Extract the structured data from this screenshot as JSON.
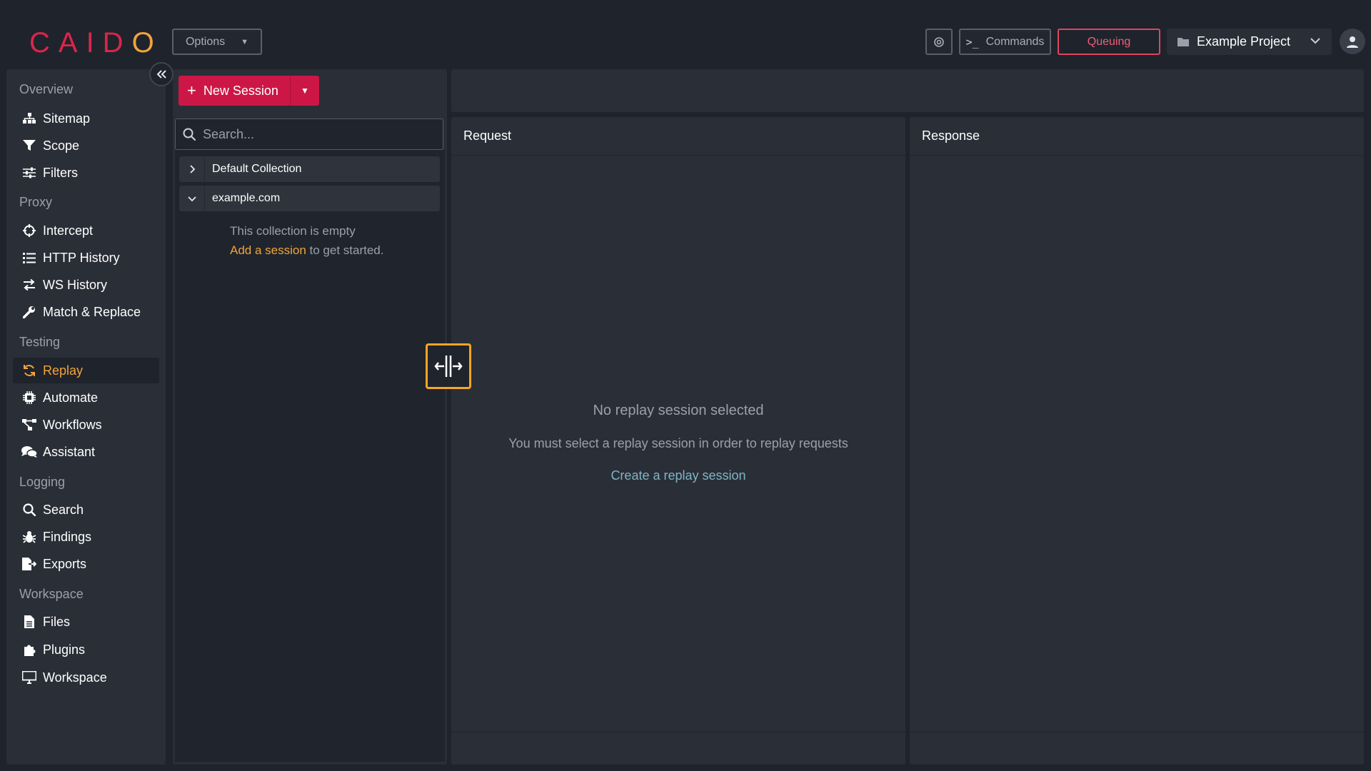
{
  "app": {
    "logo_main": "CAID",
    "logo_last": "O"
  },
  "header": {
    "options_label": "Options",
    "commands_label": "Commands",
    "queuing_label": "Queuing",
    "project_name": "Example Project"
  },
  "sidebar": {
    "sections": [
      {
        "label": "Overview"
      },
      {
        "label": "Proxy"
      },
      {
        "label": "Testing"
      },
      {
        "label": "Logging"
      },
      {
        "label": "Workspace"
      }
    ],
    "items": [
      {
        "label": "Sitemap",
        "icon": "sitemap-icon"
      },
      {
        "label": "Scope",
        "icon": "filter-icon"
      },
      {
        "label": "Filters",
        "icon": "sliders-icon"
      },
      {
        "label": "Intercept",
        "icon": "crosshair-icon"
      },
      {
        "label": "HTTP History",
        "icon": "list-icon"
      },
      {
        "label": "WS History",
        "icon": "arrows-exchange-icon"
      },
      {
        "label": "Match & Replace",
        "icon": "wrench-icon"
      },
      {
        "label": "Replay",
        "icon": "refresh-icon",
        "active": true
      },
      {
        "label": "Automate",
        "icon": "cpu-icon"
      },
      {
        "label": "Workflows",
        "icon": "workflow-icon"
      },
      {
        "label": "Assistant",
        "icon": "chat-icon"
      },
      {
        "label": "Search",
        "icon": "search-icon"
      },
      {
        "label": "Findings",
        "icon": "bug-icon"
      },
      {
        "label": "Exports",
        "icon": "file-export-icon"
      },
      {
        "label": "Files",
        "icon": "file-icon"
      },
      {
        "label": "Plugins",
        "icon": "puzzle-icon"
      },
      {
        "label": "Workspace",
        "icon": "monitor-icon"
      }
    ]
  },
  "collections": {
    "new_session_label": "New Session",
    "search_placeholder": "Search...",
    "items": [
      {
        "name": "Default Collection",
        "expanded": false
      },
      {
        "name": "example.com",
        "expanded": true
      }
    ],
    "empty_line1": "This collection is empty",
    "empty_link": "Add a session",
    "empty_suffix": " to get started."
  },
  "main": {
    "request_label": "Request",
    "response_label": "Response",
    "empty_title": "No replay session selected",
    "empty_desc": "You must select a replay session in order to replay requests",
    "empty_cta": "Create a replay session"
  },
  "colors": {
    "accent_orange": "#f0a43a",
    "brand_red": "#d8264a",
    "queuing_red": "#ef5f78",
    "splitter_highlight": "#f5a623"
  }
}
